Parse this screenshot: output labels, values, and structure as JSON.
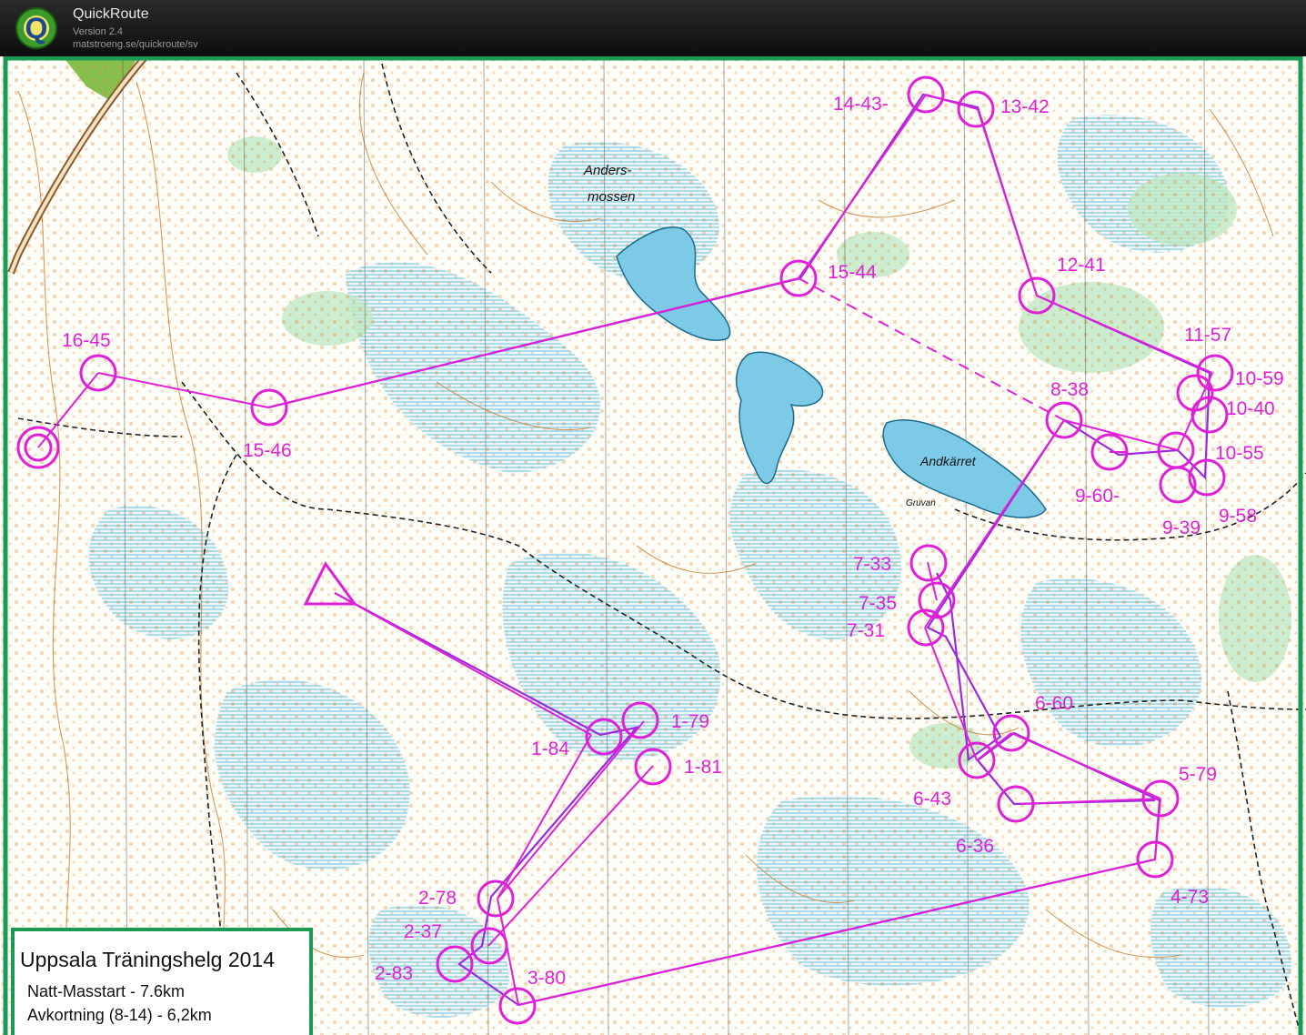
{
  "app": {
    "name": "QuickRoute",
    "version": "Version 2.4",
    "url": "matstroeng.se/quickroute/sv",
    "logo_letter": "Q"
  },
  "map": {
    "labels": {
      "andersmossen_line1": "Anders-",
      "andersmossen_line2": "mossen",
      "andkarret": "Andkärret",
      "gruvan": "Gruvan"
    },
    "controls": [
      {
        "label": "1-79"
      },
      {
        "label": "1-84"
      },
      {
        "label": "1-81"
      },
      {
        "label": "2-78"
      },
      {
        "label": "2-37"
      },
      {
        "label": "2-83"
      },
      {
        "label": "3-80"
      },
      {
        "label": "4-73"
      },
      {
        "label": "5-79"
      },
      {
        "label": "6-60"
      },
      {
        "label": "6-43"
      },
      {
        "label": "6-36"
      },
      {
        "label": "7-33"
      },
      {
        "label": "7-35"
      },
      {
        "label": "7-31"
      },
      {
        "label": "8-38"
      },
      {
        "label": "9-60-"
      },
      {
        "label": "9-39"
      },
      {
        "label": "9-58"
      },
      {
        "label": "10-59"
      },
      {
        "label": "10-40"
      },
      {
        "label": "10-55"
      },
      {
        "label": "11-57"
      },
      {
        "label": "12-41"
      },
      {
        "label": "13-42"
      },
      {
        "label": "14-43-"
      },
      {
        "label": "15-44"
      },
      {
        "label": "16-45"
      },
      {
        "label": "15-46"
      }
    ],
    "colors": {
      "course": "#e020d8",
      "route": "#9a2be0",
      "water": "#3aaed0",
      "contour": "#c8782a",
      "vegetation": "#bfe8c4",
      "frame": "#1a9a55"
    }
  },
  "legend": {
    "title": "Uppsala Träningshelg 2014",
    "line1": "Natt-Masstart - 7.6km",
    "line2": "Avkortning (8-14) - 6,2km"
  }
}
